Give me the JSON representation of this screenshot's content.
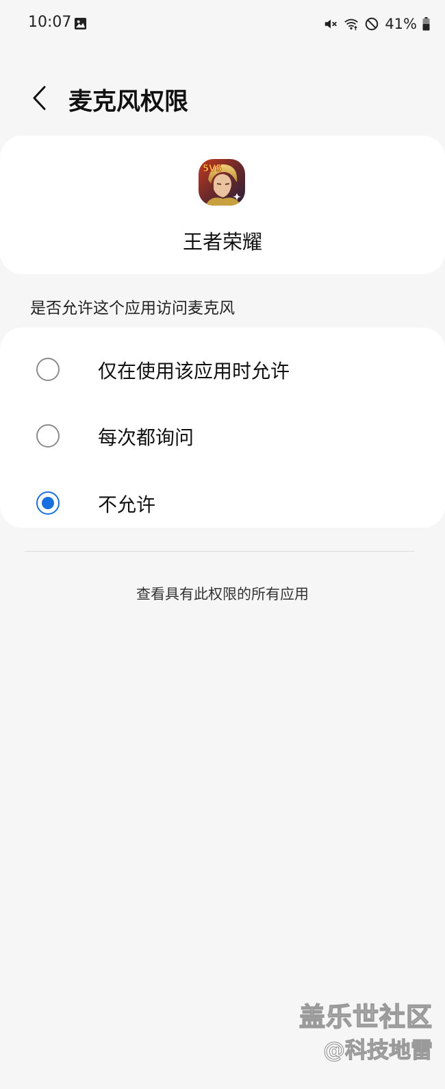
{
  "status_bar": {
    "time": "10:07",
    "battery_percent": "41%",
    "icons": [
      "gallery-icon",
      "mute-icon",
      "wifi-icon",
      "do-not-disturb-icon",
      "battery-icon"
    ]
  },
  "header": {
    "title": "麦克风权限"
  },
  "app": {
    "name": "王者荣耀",
    "icon": "app-icon-honor-of-kings"
  },
  "question": "是否允许这个应用访问麦克风",
  "options": [
    {
      "label": "仅在使用该应用时允许",
      "selected": false
    },
    {
      "label": "每次都询问",
      "selected": false
    },
    {
      "label": "不允许",
      "selected": true
    }
  ],
  "view_all_link": "查看具有此权限的所有应用",
  "watermark": {
    "line1": "盖乐世社区",
    "line2": "@科技地雷"
  },
  "colors": {
    "accent": "#1a6fe0",
    "background": "#f6f6f6",
    "card": "#ffffff"
  }
}
